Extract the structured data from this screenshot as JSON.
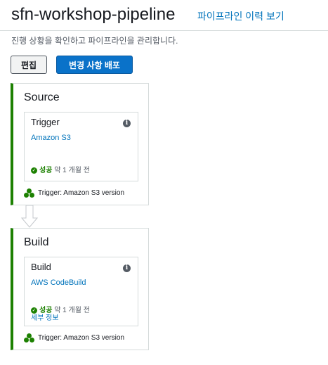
{
  "header": {
    "title": "sfn-workshop-pipeline",
    "history_link": "파이프라인 이력 보기",
    "subtitle": "진행 상황을 확인하고 파이프라인을 관리합니다."
  },
  "toolbar": {
    "edit_label": "편집",
    "deploy_label": "변경 사항 배포"
  },
  "stages": [
    {
      "name": "Source",
      "action": {
        "name": "Trigger",
        "provider": "Amazon S3",
        "status": "성공",
        "time": "약 1 개월 전"
      },
      "trigger": "Trigger: Amazon S3 version"
    },
    {
      "name": "Build",
      "action": {
        "name": "Build",
        "provider": "AWS CodeBuild",
        "status": "성공",
        "time": "약 1 개월 전",
        "details_link": "세부 정보"
      },
      "trigger": "Trigger: Amazon S3 version"
    }
  ],
  "colors": {
    "success": "#1d8102",
    "link": "#0073bb",
    "primary_button": "#0a72c9"
  },
  "icons": {
    "info": "info-icon",
    "status": "check-circle-icon",
    "trigger": "trigger-dots-icon",
    "transition": "down-arrow-icon"
  }
}
